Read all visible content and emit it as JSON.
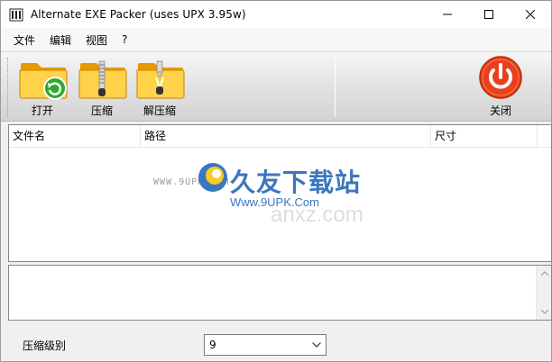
{
  "window": {
    "title": "Alternate EXE Packer (uses UPX 3.95w)"
  },
  "menu": {
    "items": [
      "文件",
      "编辑",
      "视图",
      "?"
    ]
  },
  "toolbar": {
    "open_label": "打开",
    "compress_label": "压缩",
    "decompress_label": "解压缩",
    "close_label": "关闭"
  },
  "list": {
    "columns": [
      "文件名",
      "路径",
      "尺寸"
    ]
  },
  "watermark": {
    "small": "WWW.9UPK.COM",
    "title": "久友下载站",
    "url": "Www.9UPK.Com",
    "faint": "anxz.com"
  },
  "settings": {
    "level_label": "压缩级别",
    "level_value": "9"
  },
  "colors": {
    "folder": "#f7b500",
    "close_red": "#e8401c",
    "watermark_blue": "#1a5fb4"
  }
}
